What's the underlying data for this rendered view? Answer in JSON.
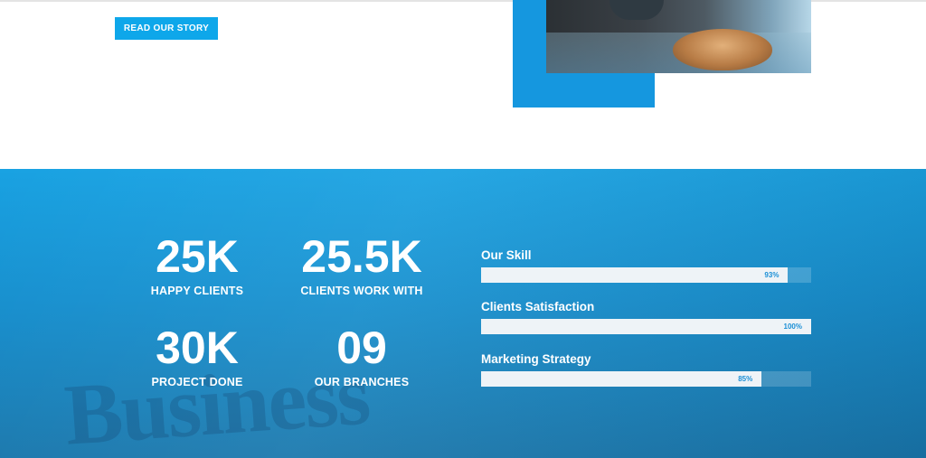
{
  "hero": {
    "read_button_label": "READ OUR STORY"
  },
  "stats": {
    "watermark_text": "Business",
    "items": [
      {
        "value": "25K",
        "label": "HAPPY CLIENTS"
      },
      {
        "value": "25.5K",
        "label": "CLIENTS WORK WITH"
      },
      {
        "value": "30K",
        "label": "PROJECT DONE"
      },
      {
        "value": "09",
        "label": "OUR BRANCHES"
      }
    ]
  },
  "skills": {
    "items": [
      {
        "label": "Our Skill",
        "percent": 93,
        "percent_text": "93%"
      },
      {
        "label": "Clients Satisfaction",
        "percent": 100,
        "percent_text": "100%"
      },
      {
        "label": "Marketing Strategy",
        "percent": 85,
        "percent_text": "85%"
      }
    ]
  },
  "colors": {
    "accent": "#0ea7ea",
    "section_top": "#19a2e2",
    "section_bottom": "#1a78ad",
    "bar_fill": "#eef3f7",
    "percent_text": "#1a8fd6"
  }
}
